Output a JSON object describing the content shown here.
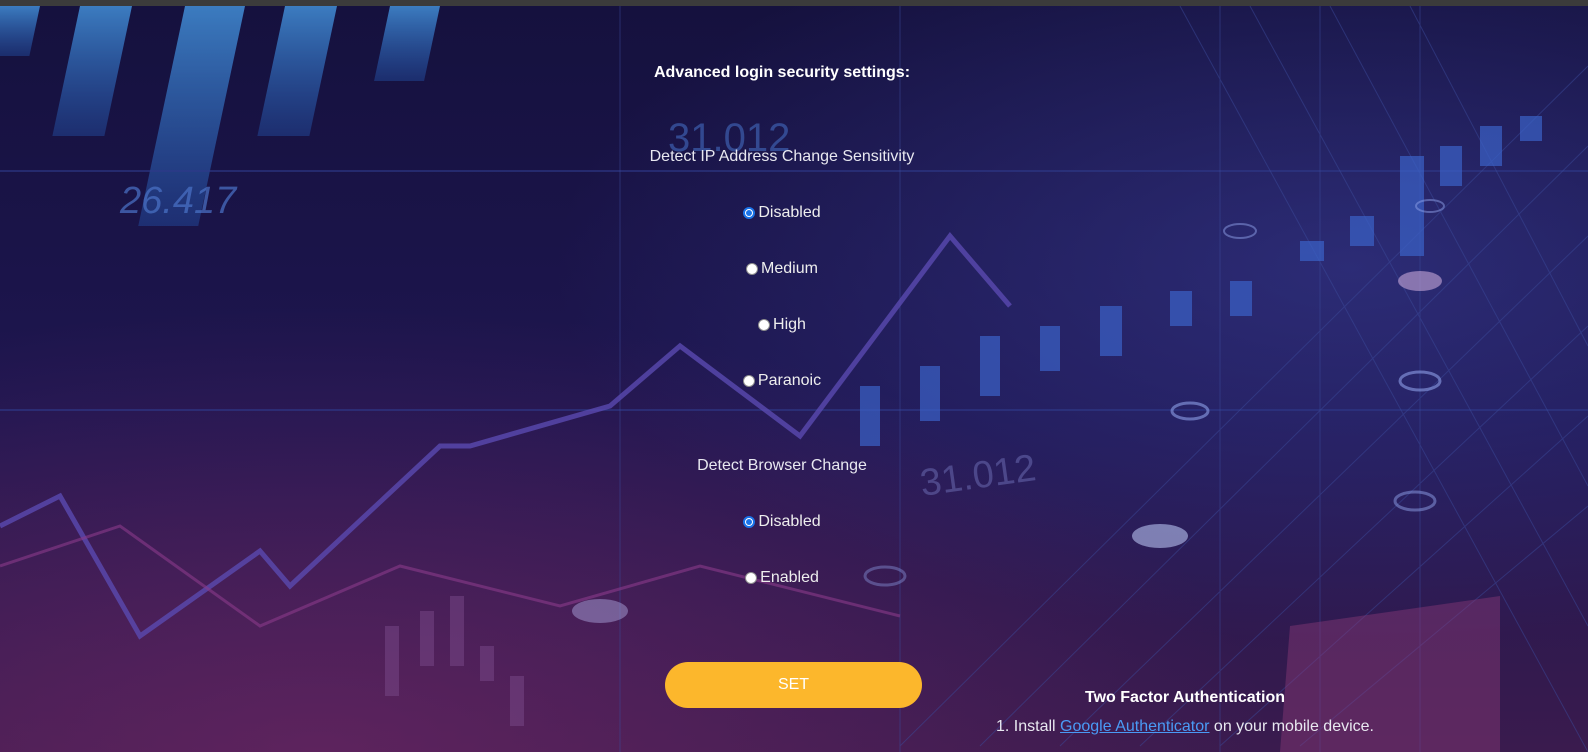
{
  "page": {
    "heading": "Advanced login security settings:"
  },
  "background": {
    "numbers": [
      "31.012",
      "26.417",
      "31.012"
    ]
  },
  "ip_sensitivity": {
    "title": "Detect IP Address Change Sensitivity",
    "options": [
      {
        "label": "Disabled",
        "selected": true
      },
      {
        "label": "Medium",
        "selected": false
      },
      {
        "label": "High",
        "selected": false
      },
      {
        "label": "Paranoic",
        "selected": false
      }
    ]
  },
  "browser_change": {
    "title": "Detect Browser Change",
    "options": [
      {
        "label": "Disabled",
        "selected": true
      },
      {
        "label": "Enabled",
        "selected": false
      }
    ]
  },
  "actions": {
    "set_label": "SET"
  },
  "two_factor": {
    "title": "Two Factor Authentication",
    "step1_prefix": "1. Install ",
    "step1_link": "Google Authenticator",
    "step1_suffix": " on your mobile device."
  },
  "colors": {
    "background": "#14113b",
    "accent_button": "#fcb72c",
    "radio_checked": "#1a73e8",
    "link": "#4a9af5"
  }
}
